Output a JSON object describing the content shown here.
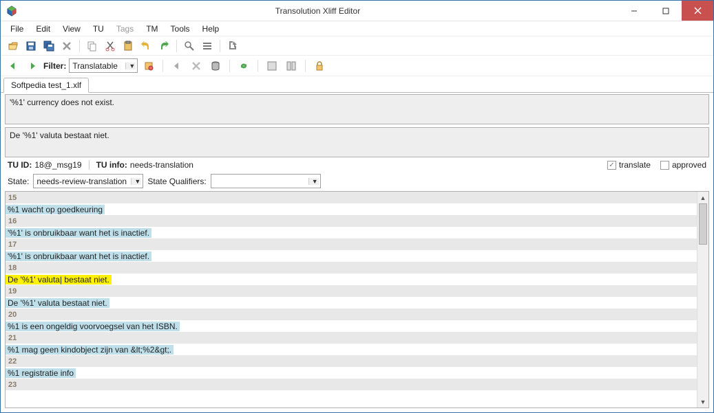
{
  "window": {
    "title": "Transolution Xliff Editor"
  },
  "menubar": [
    "File",
    "Edit",
    "View",
    "TU",
    "Tags",
    "TM",
    "Tools",
    "Help"
  ],
  "menubar_disabled": [
    "Tags"
  ],
  "filterbar": {
    "label": "Filter:",
    "value": "Translatable"
  },
  "tabs": [
    "Softpedia test_1.xlf"
  ],
  "source_text": "'%1' currency does not exist.",
  "target_text": "De '%1' valuta bestaat niet.",
  "info": {
    "tu_id_label": "TU ID:",
    "tu_id_value": "18@_msg19",
    "tu_info_label": "TU info:",
    "tu_info_value": "needs-translation",
    "translate_label": "translate",
    "approved_label": "approved",
    "translate_checked": true,
    "approved_checked": false
  },
  "statebar": {
    "state_label": "State:",
    "state_value": "needs-review-translation",
    "qualifiers_label": "State Qualifiers:",
    "qualifiers_value": ""
  },
  "rows": [
    {
      "type": "num",
      "n": "15"
    },
    {
      "type": "txt",
      "text": "%1 wacht op goedkeuring",
      "style": "blue"
    },
    {
      "type": "num",
      "n": "16"
    },
    {
      "type": "txt",
      "text": "'%1' is onbruikbaar want het is inactief.",
      "style": "blue"
    },
    {
      "type": "num",
      "n": "17"
    },
    {
      "type": "txt",
      "text": "'%1' is onbruikbaar want het is inactief.",
      "style": "blue"
    },
    {
      "type": "num",
      "n": "18"
    },
    {
      "type": "txt",
      "text": "De '%1' valuta| bestaat niet.",
      "style": "yellow"
    },
    {
      "type": "num",
      "n": "19"
    },
    {
      "type": "txt",
      "text": "De '%1' valuta bestaat niet.",
      "style": "blue"
    },
    {
      "type": "num",
      "n": "20"
    },
    {
      "type": "txt",
      "text": "%1 is een ongeldig voorvoegsel van het ISBN.",
      "style": "blue"
    },
    {
      "type": "num",
      "n": "21"
    },
    {
      "type": "txt",
      "text": "%1 mag geen kindobject zijn van &lt;%2&gt;.",
      "style": "blue"
    },
    {
      "type": "num",
      "n": "22"
    },
    {
      "type": "txt",
      "text": "%1 registratie info",
      "style": "blue"
    },
    {
      "type": "num",
      "n": "23"
    }
  ]
}
